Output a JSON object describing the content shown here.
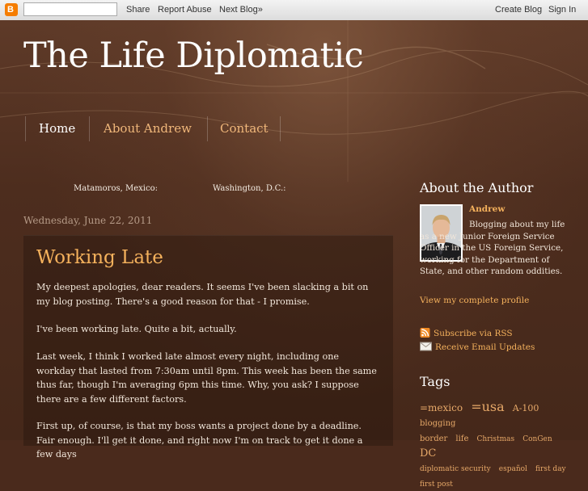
{
  "navbar": {
    "logo_letter": "B",
    "search_value": "",
    "share": "Share",
    "report_abuse": "Report Abuse",
    "next_blog": "Next Blog»",
    "create_blog": "Create Blog",
    "sign_in": "Sign In"
  },
  "header": {
    "title": "The Life Diplomatic",
    "tabs": [
      {
        "label": "Home"
      },
      {
        "label": "About Andrew"
      },
      {
        "label": "Contact"
      }
    ]
  },
  "clocks": [
    {
      "label": "Matamoros, Mexico:"
    },
    {
      "label": "Washington, D.C.:"
    }
  ],
  "post": {
    "date": "Wednesday, June 22, 2011",
    "title": "Working Late",
    "paragraphs": [
      "My deepest apologies, dear readers. It seems I've been slacking a bit on my blog posting. There's a good reason for that - I promise.",
      "I've been working late. Quite a bit, actually.",
      "Last week, I think I worked late almost every night, including one workday that lasted from 7:30am until 8pm. This week has been the same thus far, though I'm averaging 6pm this time. Why, you ask? I suppose there are a few different factors.",
      "First up, of course, is that my boss wants a project done by a deadline. Fair enough. I'll get it done, and right now I'm on track to get it done a few days"
    ]
  },
  "sidebar": {
    "about_heading": "About the Author",
    "author_name": "Andrew",
    "author_bio": "Blogging about my life as a new Junior Foreign Service Officer in the US Foreign Service, working for the Department of State, and other random oddities.",
    "profile_link": "View my complete profile",
    "subscribe_rss": "Subscribe via RSS",
    "email_updates": "Receive Email Updates",
    "tags_heading": "Tags",
    "tags": [
      {
        "label": "=mexico",
        "size": 12
      },
      {
        "label": "=usa",
        "size": 16
      },
      {
        "label": "A-100",
        "size": 11
      },
      {
        "label": "blogging",
        "size": 10
      },
      {
        "label": "border",
        "size": 10
      },
      {
        "label": "life",
        "size": 10
      },
      {
        "label": "Christmas",
        "size": 9
      },
      {
        "label": "ConGen",
        "size": 9
      },
      {
        "label": "DC",
        "size": 13
      },
      {
        "label": "diplomatic security",
        "size": 9
      },
      {
        "label": "español",
        "size": 9
      },
      {
        "label": "first day",
        "size": 9
      },
      {
        "label": "first post",
        "size": 9
      }
    ]
  },
  "colors": {
    "accent": "#f4b15c",
    "background": "#4a2a1c",
    "blogger_orange": "#f57d00"
  }
}
